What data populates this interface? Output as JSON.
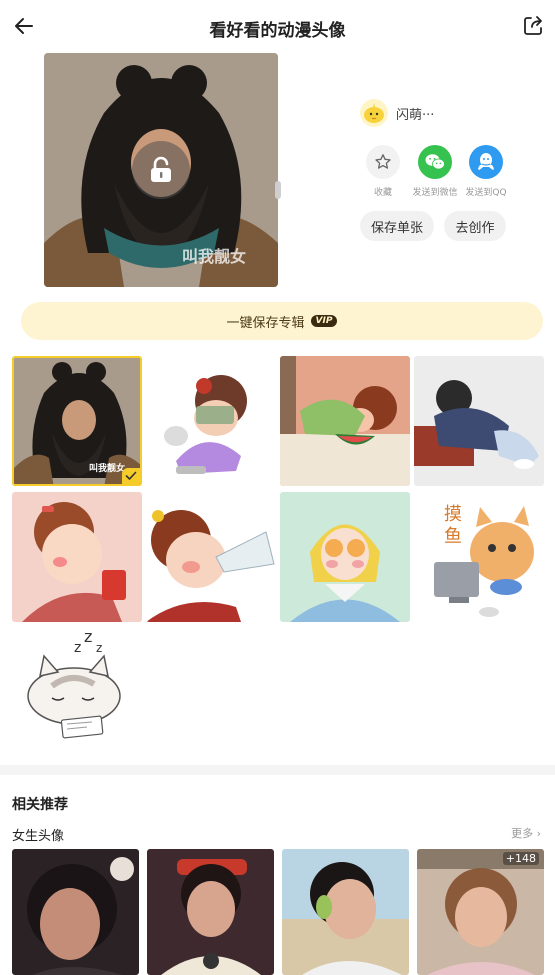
{
  "header": {
    "title": "看好看的动漫头像",
    "back_icon": "arrow-left-icon",
    "share_icon": "share-icon"
  },
  "preview": {
    "watermark": "叫我靓女",
    "lock_icon": "lock-icon"
  },
  "author": {
    "name": "闪萌···",
    "avatar_icon": "yellow-chick-avatar"
  },
  "actions": [
    {
      "label": "收藏",
      "icon": "star-icon"
    },
    {
      "label": "发送到微信",
      "icon": "wechat-icon"
    },
    {
      "label": "发送到QQ",
      "icon": "qq-icon"
    }
  ],
  "buttons": {
    "save_single": "保存单张",
    "create": "去创作"
  },
  "save_album": {
    "label": "一键保存专辑",
    "badge": "VIP"
  },
  "grid": {
    "items": [
      {
        "name": "bearded-warrior",
        "watermark": "叫我靓女",
        "selected": true
      },
      {
        "name": "girl-money-glasses"
      },
      {
        "name": "girl-eating-watermelon"
      },
      {
        "name": "girl-lying-on-table"
      },
      {
        "name": "girl-rosy-cheeks"
      },
      {
        "name": "girl-drinking-bottle"
      },
      {
        "name": "girl-yellow-headscarf"
      },
      {
        "name": "cat-at-computer-mo-yu"
      },
      {
        "name": "cat-sleeping-zzz"
      }
    ]
  },
  "related": {
    "title": "相关推荐",
    "section": "女生头像",
    "more": "更多",
    "count_badge": "+148"
  },
  "colors": {
    "accent_yellow": "#f5cc2a",
    "wechat_green": "#35c24e",
    "qq_blue": "#2e9af0",
    "vip_bar": "#fff4d2"
  }
}
